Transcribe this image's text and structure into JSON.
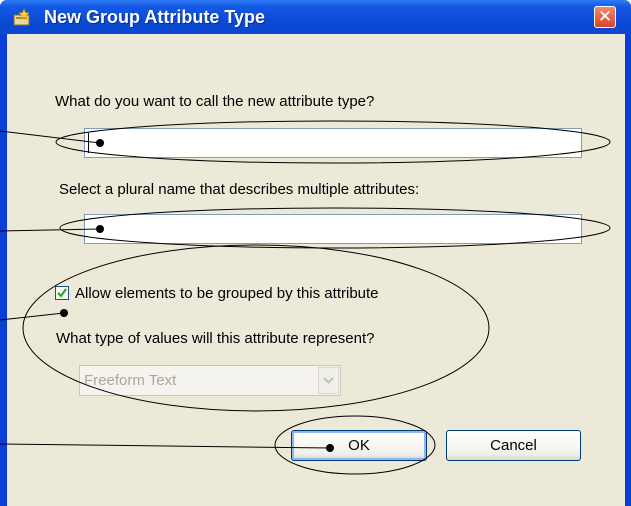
{
  "window": {
    "title": "New Group Attribute Type",
    "close_glyph": "✕"
  },
  "fields": {
    "name_prompt": "What do you want to call the new attribute type?",
    "name_value": "",
    "plural_prompt": "Select a plural name that describes multiple attributes:",
    "plural_value": ""
  },
  "grouping": {
    "checkbox_label": "Allow elements to be grouped by this attribute",
    "checked": true,
    "type_prompt": "What type of values will this attribute represent?",
    "type_selected": "Freeform Text"
  },
  "buttons": {
    "ok_label": "OK",
    "cancel_label": "Cancel"
  },
  "icons": {
    "title_icon": "new-attribute-icon",
    "close_icon": "close-icon",
    "dropdown_icon": "chevron-down-icon",
    "check_icon": "checkmark-icon"
  },
  "colors": {
    "title_bar": "#0a4ad6",
    "dialog_bg": "#ece9d8",
    "close_button": "#d9432a",
    "annotation": "#000000"
  }
}
